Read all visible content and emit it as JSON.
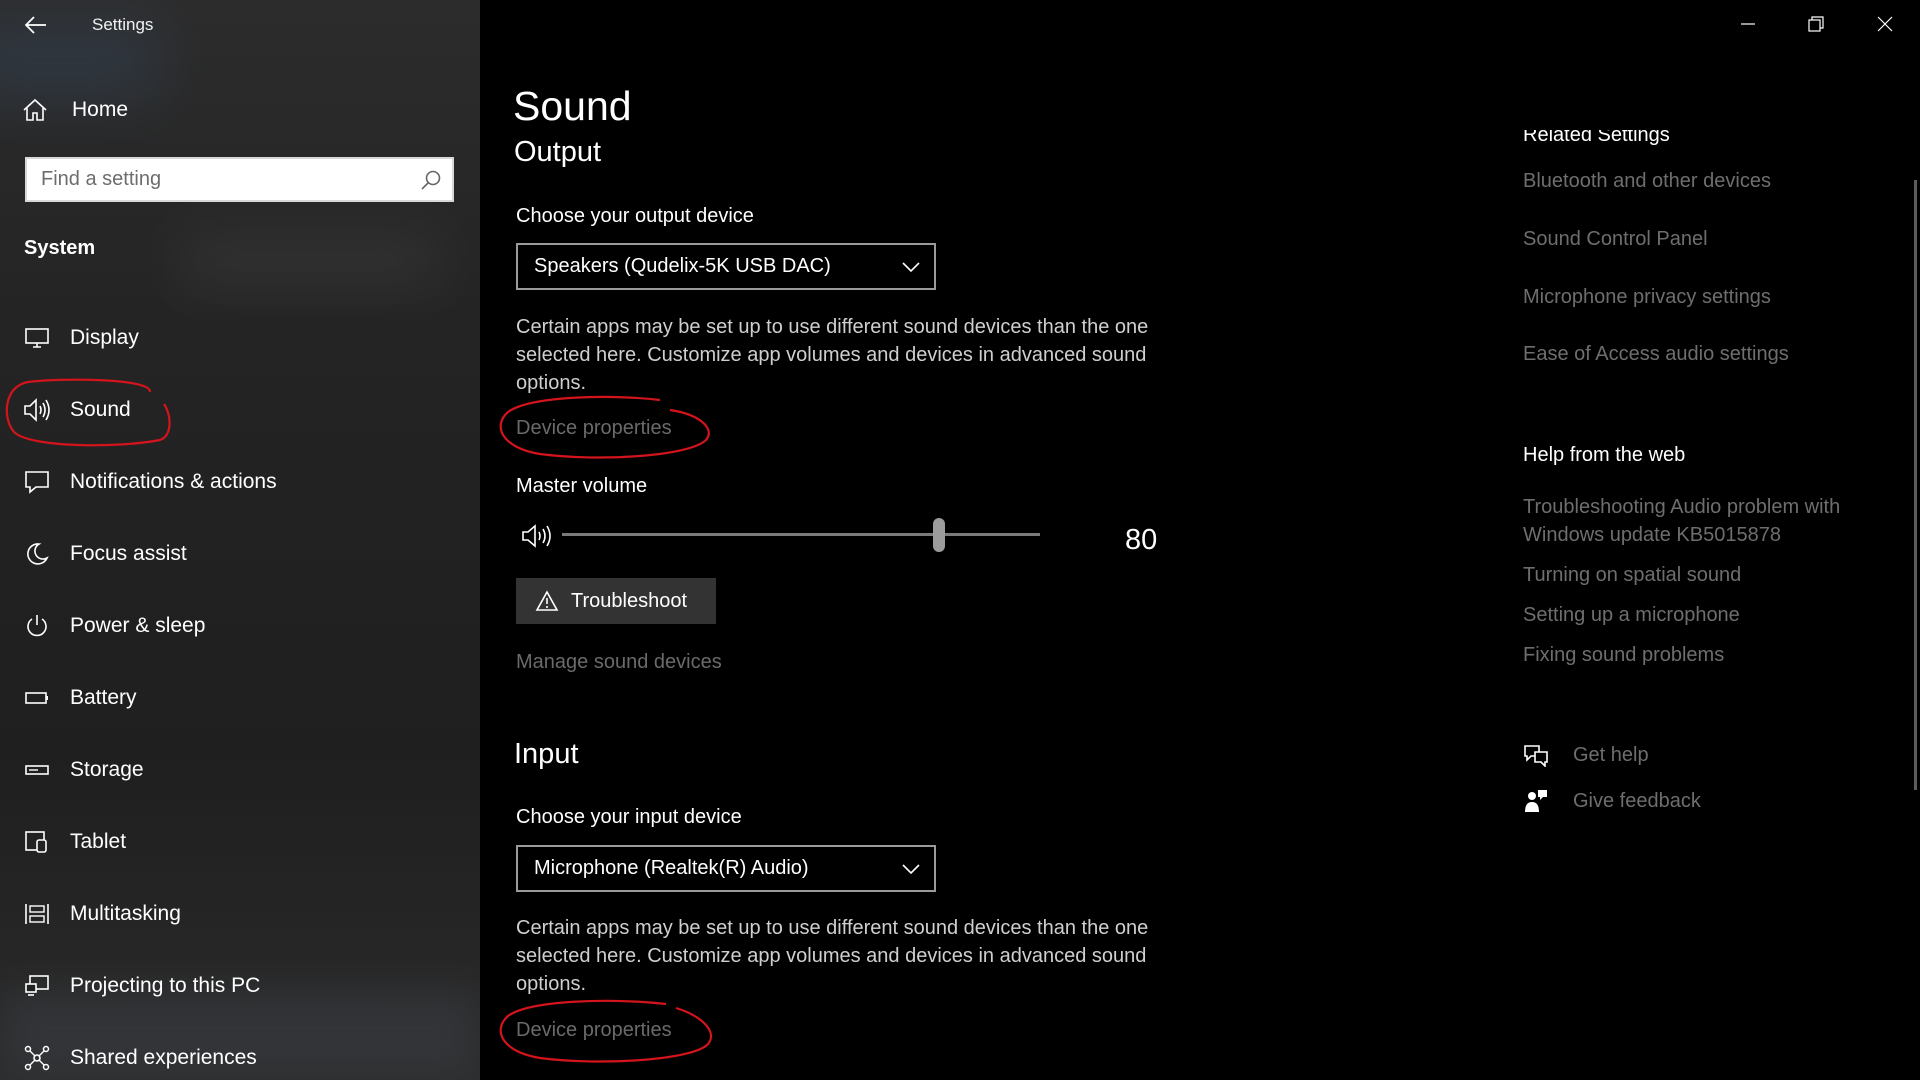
{
  "window": {
    "title": "Settings"
  },
  "sidebar": {
    "home_label": "Home",
    "search_placeholder": "Find a setting",
    "section_label": "System",
    "items": [
      {
        "label": "Display",
        "icon": "monitor-icon"
      },
      {
        "label": "Sound",
        "icon": "speaker-icon"
      },
      {
        "label": "Notifications & actions",
        "icon": "notification-icon"
      },
      {
        "label": "Focus assist",
        "icon": "moon-icon"
      },
      {
        "label": "Power & sleep",
        "icon": "power-icon"
      },
      {
        "label": "Battery",
        "icon": "battery-icon"
      },
      {
        "label": "Storage",
        "icon": "storage-icon"
      },
      {
        "label": "Tablet",
        "icon": "tablet-icon"
      },
      {
        "label": "Multitasking",
        "icon": "multitasking-icon"
      },
      {
        "label": "Projecting to this PC",
        "icon": "projecting-icon"
      },
      {
        "label": "Shared experiences",
        "icon": "shared-icon"
      }
    ]
  },
  "main": {
    "title": "Sound",
    "output": {
      "heading": "Output",
      "choose_label": "Choose your output device",
      "device": "Speakers (Qudelix-5K USB DAC)",
      "description": "Certain apps may be set up to use different sound devices than the one selected here. Customize app volumes and devices in advanced sound options.",
      "device_properties": "Device properties",
      "master_volume_label": "Master volume",
      "volume": 80,
      "troubleshoot_label": "Troubleshoot",
      "manage_label": "Manage sound devices"
    },
    "input": {
      "heading": "Input",
      "choose_label": "Choose your input device",
      "device": "Microphone (Realtek(R) Audio)",
      "description": "Certain apps may be set up to use different sound devices than the one selected here. Customize app volumes and devices in advanced sound options.",
      "device_properties": "Device properties"
    }
  },
  "right": {
    "related_heading": "Related Settings",
    "related_links": [
      "Bluetooth and other devices",
      "Sound Control Panel",
      "Microphone privacy settings",
      "Ease of Access audio settings"
    ],
    "help_heading": "Help from the web",
    "help_links": [
      "Troubleshooting Audio problem with Windows update KB5015878",
      "Turning on spatial sound",
      "Setting up a microphone",
      "Fixing sound problems"
    ],
    "get_help": "Get help",
    "give_feedback": "Give feedback"
  },
  "colors": {
    "annotation": "#d4141c",
    "dim_link": "#6e6e6e",
    "background": "#000000"
  }
}
